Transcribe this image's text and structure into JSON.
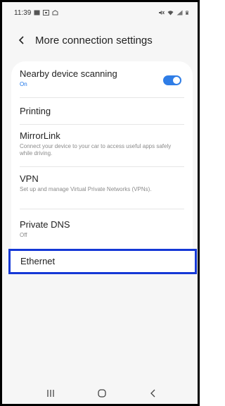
{
  "status_bar": {
    "time": "11:39",
    "icons": [
      "gallery-icon",
      "screenshot-icon",
      "notification-icon",
      "mute-icon",
      "wifi-icon",
      "signal-icon",
      "battery-icon"
    ]
  },
  "header": {
    "title": "More connection settings",
    "back_icon": "chevron-left-icon"
  },
  "settings": {
    "nearby": {
      "title": "Nearby device scanning",
      "subtitle": "On",
      "toggle_on": true
    },
    "printing": {
      "title": "Printing"
    },
    "mirrorlink": {
      "title": "MirrorLink",
      "subtitle": "Connect your device to your car to access useful apps safely while driving."
    },
    "vpn": {
      "title": "VPN",
      "subtitle": "Set up and manage Virtual Private Networks (VPNs)."
    },
    "private_dns": {
      "title": "Private DNS",
      "subtitle": "Off"
    },
    "ethernet": {
      "title": "Ethernet"
    }
  },
  "navbar": {
    "items": [
      "recents-icon",
      "home-icon",
      "back-icon"
    ]
  },
  "colors": {
    "accent": "#2f7de6",
    "highlight_border": "#1538d6"
  }
}
